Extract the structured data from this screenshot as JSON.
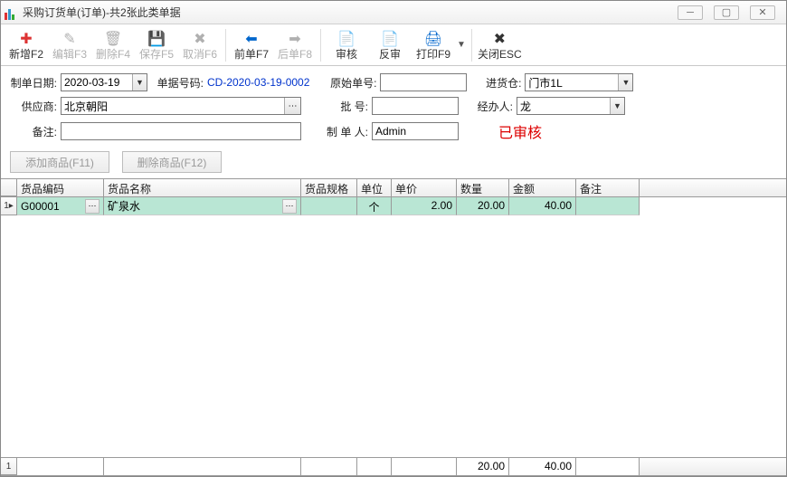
{
  "window": {
    "title": "采购订货单(订单)-共2张此类单据"
  },
  "toolbar": {
    "new": "新增F2",
    "edit": "编辑F3",
    "delete": "删除F4",
    "save": "保存F5",
    "cancel": "取消F6",
    "prev": "前单F7",
    "next": "后单F8",
    "audit": "审核",
    "unaudit": "反审",
    "print": "打印F9",
    "close": "关闭ESC"
  },
  "form": {
    "date_label": "制单日期:",
    "date_value": "2020-03-19",
    "docnum_label": "单据号码:",
    "docnum_value": "CD-2020-03-19-0002",
    "origdoc_label": "原始单号:",
    "origdoc_value": "",
    "warehouse_label": "进货仓:",
    "warehouse_value": "门市1L",
    "supplier_label": "供应商:",
    "supplier_value": "北京朝阳",
    "batch_label": "批    号:",
    "batch_value": "",
    "handler_label": "经办人:",
    "handler_value": "龙",
    "remark_label": "备注:",
    "remark_value": "",
    "maker_label": "制 单 人:",
    "maker_value": "Admin",
    "audited_stamp": "已审核"
  },
  "buttons": {
    "add_item": "添加商品(F11)",
    "del_item": "删除商品(F12)"
  },
  "grid": {
    "headers": {
      "code": "货品编码",
      "name": "货品名称",
      "spec": "货品规格",
      "unit": "单位",
      "price": "单价",
      "qty": "数量",
      "amount": "金额",
      "remark": "备注"
    },
    "rows": [
      {
        "indicator": "1▸",
        "code": "G00001",
        "name": "矿泉水",
        "spec": "",
        "unit": "个",
        "price": "2.00",
        "qty": "20.00",
        "amount": "40.00",
        "remark": ""
      }
    ],
    "footer": {
      "indicator": "1",
      "qty": "20.00",
      "amount": "40.00"
    }
  }
}
